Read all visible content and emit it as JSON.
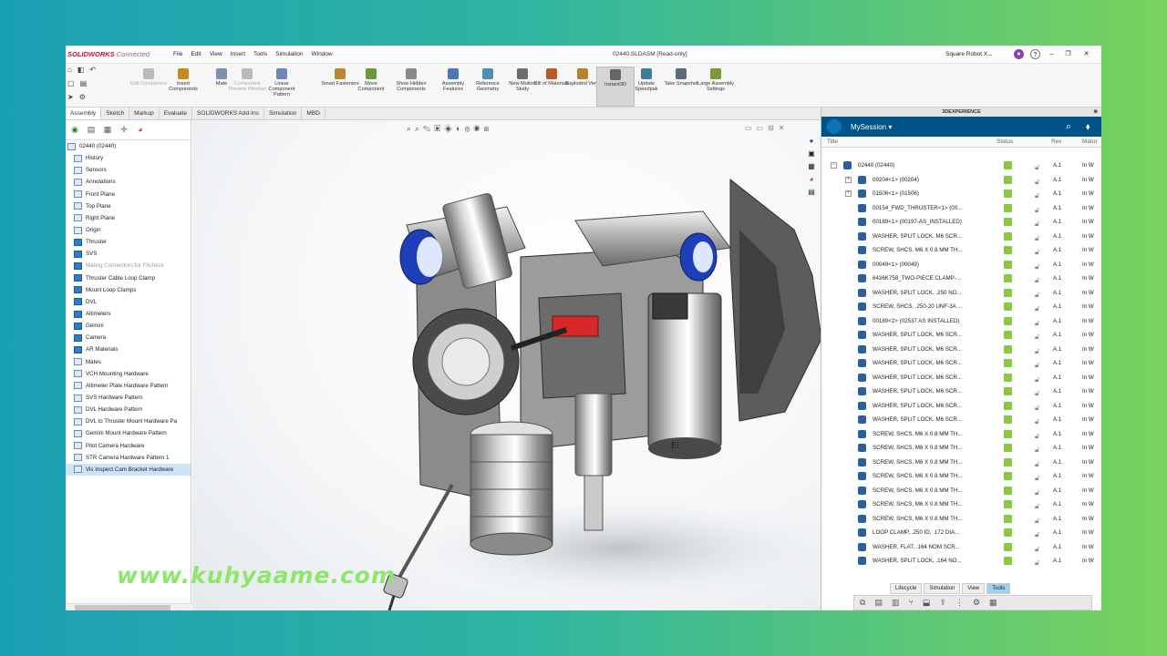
{
  "app": {
    "logo_brand": "SOLIDWORKS",
    "logo_suffix": "Connected",
    "document_title": "02440.SLDASM [Read-only]",
    "user": "Square Robot X..."
  },
  "menu": [
    "File",
    "Edit",
    "View",
    "Insert",
    "Tools",
    "Simulation",
    "Window"
  ],
  "ribbon": [
    {
      "label": "Edit Component",
      "dim": true
    },
    {
      "label": "Insert Components"
    },
    {
      "label": "Mate"
    },
    {
      "label": "Component Preview Window",
      "dim": true
    },
    {
      "label": "Linear Component Pattern"
    },
    {
      "label": "Smart Fasteners"
    },
    {
      "label": "Move Component"
    },
    {
      "label": "Show Hidden Components"
    },
    {
      "label": "Assembly Features"
    },
    {
      "label": "Reference Geometry"
    },
    {
      "label": "New Motion Study"
    },
    {
      "label": "Bill of Materials"
    },
    {
      "label": "Exploded View"
    },
    {
      "label": "Instant3D",
      "active": true
    },
    {
      "label": "Update Speedpak"
    },
    {
      "label": "Take Snapshot"
    },
    {
      "label": "Large Assembly Settings"
    }
  ],
  "tabs": [
    "Assembly",
    "Sketch",
    "Markup",
    "Evaluate",
    "SOLIDWORKS Add-Ins",
    "Simulation",
    "MBD"
  ],
  "tree": [
    {
      "label": "02440 (02440)",
      "dim": false
    },
    {
      "label": "History"
    },
    {
      "label": "Sensors"
    },
    {
      "label": "Annotations"
    },
    {
      "label": "Front Plane"
    },
    {
      "label": "Top Plane"
    },
    {
      "label": "Right Plane"
    },
    {
      "label": "Origin"
    },
    {
      "label": "Thruster"
    },
    {
      "label": "SVS"
    },
    {
      "label": "Mating Connectors for Fitcheck",
      "dim": true
    },
    {
      "label": "Thruster Cable Loop Clamp"
    },
    {
      "label": "Mount Loop Clamps"
    },
    {
      "label": "DVL"
    },
    {
      "label": "Altimeters"
    },
    {
      "label": "Gemini"
    },
    {
      "label": "Camera"
    },
    {
      "label": "AR Materials"
    },
    {
      "label": "Mates"
    },
    {
      "label": "VCH Mounting Hardware"
    },
    {
      "label": "Altimeter Plate Hardware Pattern"
    },
    {
      "label": "SVS Hardware Pattern"
    },
    {
      "label": "DVL Hardware Pattern"
    },
    {
      "label": "DVL to Thruster Mount Hardware Pa"
    },
    {
      "label": "Gemini Mount Hardware Pattern"
    },
    {
      "label": "Pilot Camera Hardware"
    },
    {
      "label": "STR Camera Hardware Pattern 1"
    },
    {
      "label": "Vis Inspect Cam Bracket Hardware",
      "sel": true
    }
  ],
  "xp": {
    "header": "3DEXPERIENCE",
    "session": "MySession",
    "columns": {
      "title": "Title",
      "status": "Status",
      "rev": "Rev",
      "maturity": "Matur"
    },
    "rows": [
      {
        "name": "02440 (02440)",
        "level": 0,
        "rev": "A.1",
        "mat": "In W"
      },
      {
        "name": "00204<1> (00204)",
        "level": 1,
        "rev": "A.1",
        "mat": "In W"
      },
      {
        "name": "01506<1> (01506)",
        "level": 1,
        "rev": "A.1",
        "mat": "In W"
      },
      {
        "name": "00154_FWD_THRUSTER<1> (00...",
        "level": 2,
        "rev": "A.1",
        "mat": "In W"
      },
      {
        "name": "00189<1> (00197-AS_INSTALLED)",
        "level": 2,
        "rev": "A.1",
        "mat": "In W"
      },
      {
        "name": "WASHER, SPLIT LOCK, M6 SCR...",
        "level": 2,
        "rev": "A.1",
        "mat": "In W"
      },
      {
        "name": "SCREW, SHCS, M6 X 0.8 MM TH...",
        "level": 2,
        "rev": "A.1",
        "mat": "In W"
      },
      {
        "name": "00049<1> (00049)",
        "level": 2,
        "rev": "A.1",
        "mat": "In W"
      },
      {
        "name": "6436K758_TWO-PIECE CLAMP-...",
        "level": 2,
        "rev": "A.1",
        "mat": "In W"
      },
      {
        "name": "WASHER, SPLIT LOCK, .250 NO...",
        "level": 2,
        "rev": "A.1",
        "mat": "In W"
      },
      {
        "name": "SCREW, SHCS, .250-20 UNF-3A ...",
        "level": 2,
        "rev": "A.1",
        "mat": "In W"
      },
      {
        "name": "00189<2> (02537 AS INSTALLED)",
        "level": 2,
        "rev": "A.1",
        "mat": "In W"
      },
      {
        "name": "WASHER, SPLIT LOCK, M6 SCR...",
        "level": 2,
        "rev": "A.1",
        "mat": "In W"
      },
      {
        "name": "WASHER, SPLIT LOCK, M6 SCR...",
        "level": 2,
        "rev": "A.1",
        "mat": "In W"
      },
      {
        "name": "WASHER, SPLIT LOCK, M6 SCR...",
        "level": 2,
        "rev": "A.1",
        "mat": "In W"
      },
      {
        "name": "WASHER, SPLIT LOCK, M6 SCR...",
        "level": 2,
        "rev": "A.1",
        "mat": "In W"
      },
      {
        "name": "WASHER, SPLIT LOCK, M6 SCR...",
        "level": 2,
        "rev": "A.1",
        "mat": "In W"
      },
      {
        "name": "WASHER, SPLIT LOCK, M6 SCR...",
        "level": 2,
        "rev": "A.1",
        "mat": "In W"
      },
      {
        "name": "WASHER, SPLIT LOCK, M6 SCR...",
        "level": 2,
        "rev": "A.1",
        "mat": "In W"
      },
      {
        "name": "SCREW, SHCS, M6 X 0.8 MM TH...",
        "level": 2,
        "rev": "A.1",
        "mat": "In W"
      },
      {
        "name": "SCREW, SHCS, M6 X 0.8 MM TH...",
        "level": 2,
        "rev": "A.1",
        "mat": "In W"
      },
      {
        "name": "SCREW, SHCS, M6 X 0.8 MM TH...",
        "level": 2,
        "rev": "A.1",
        "mat": "In W"
      },
      {
        "name": "SCREW, SHCS, M6 X 0.8 MM TH...",
        "level": 2,
        "rev": "A.1",
        "mat": "In W"
      },
      {
        "name": "SCREW, SHCS, M6 X 0.8 MM TH...",
        "level": 2,
        "rev": "A.1",
        "mat": "In W"
      },
      {
        "name": "SCREW, SHCS, M6 X 0.8 MM TH...",
        "level": 2,
        "rev": "A.1",
        "mat": "In W"
      },
      {
        "name": "SCREW, SHCS, M6 X 0.8 MM TH...",
        "level": 2,
        "rev": "A.1",
        "mat": "In W"
      },
      {
        "name": "LOOP CLAMP, .250 ID, .172 DIA...",
        "level": 2,
        "rev": "A.1",
        "mat": "In W"
      },
      {
        "name": "WASHER, FLAT, .164 NOM SCR...",
        "level": 2,
        "rev": "A.1",
        "mat": "In W"
      },
      {
        "name": "WASHER, SPLIT LOCK, .164 NO...",
        "level": 2,
        "rev": "A.1",
        "mat": "In W"
      }
    ],
    "bottom_tabs": [
      "Lifecycle",
      "Simulation",
      "View",
      "Tools"
    ]
  },
  "watermark": "www.kuhyaame.com"
}
